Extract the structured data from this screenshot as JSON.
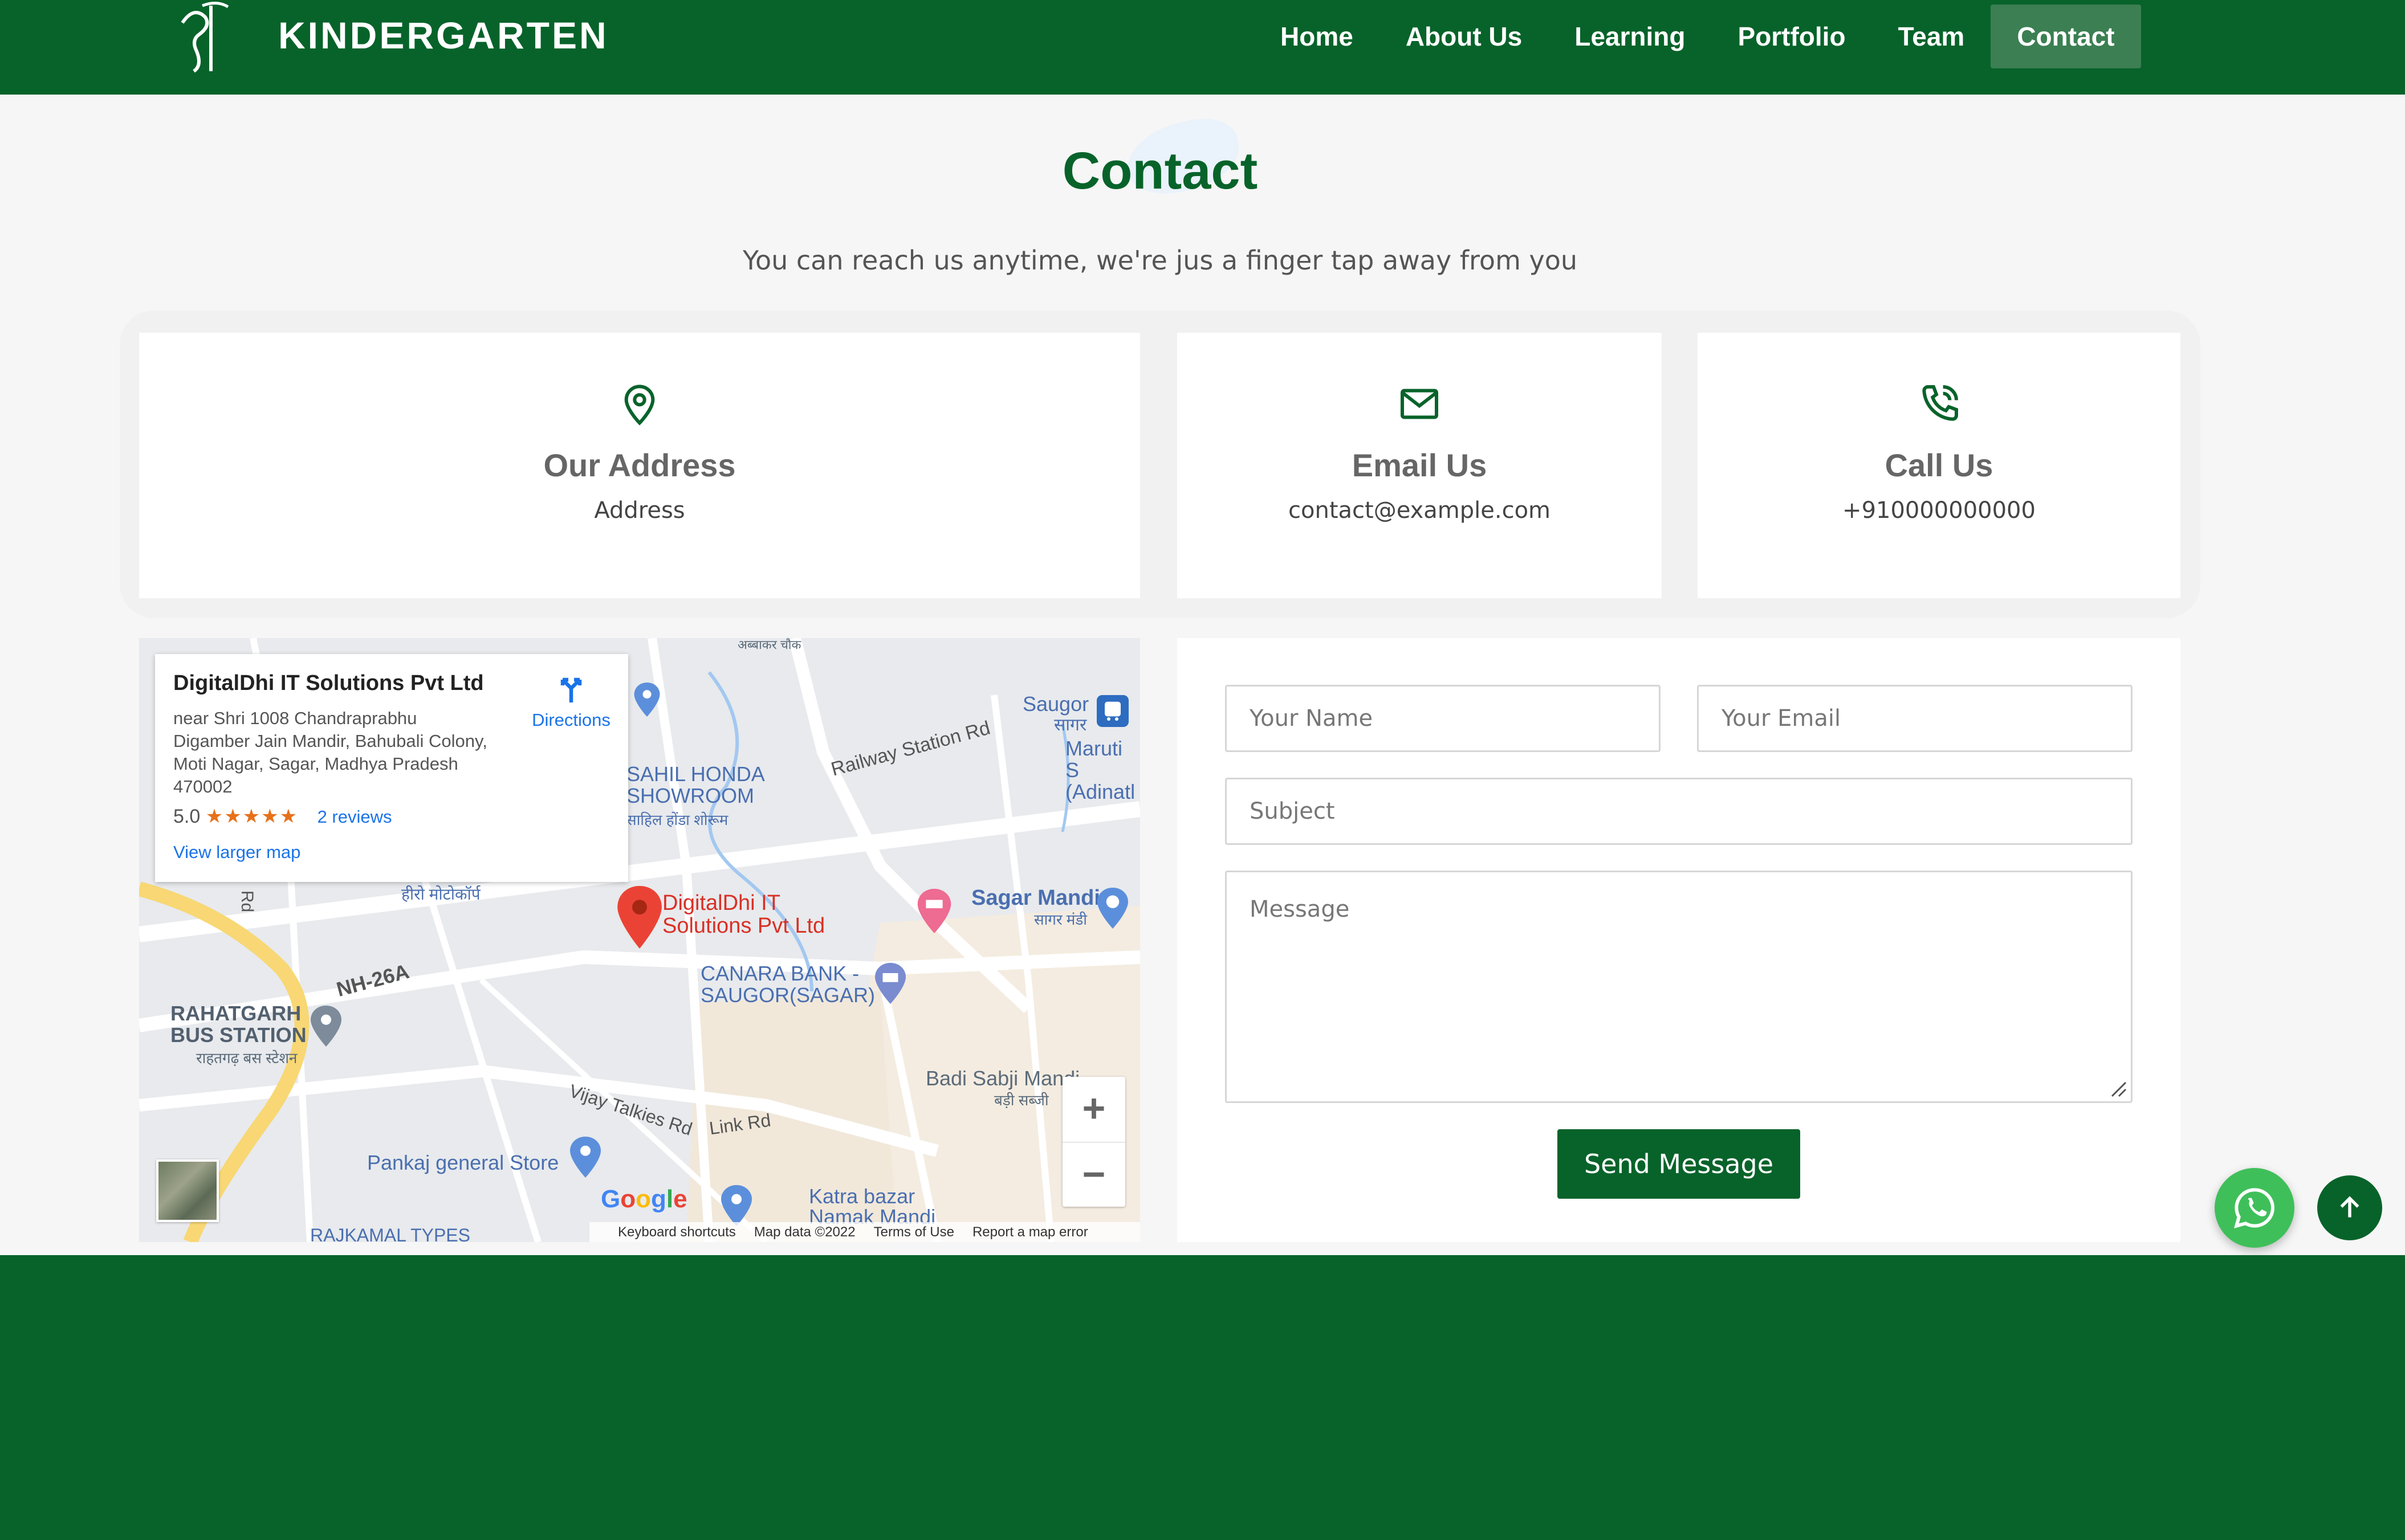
{
  "header": {
    "brand": "KINDERGARTEN",
    "nav": [
      "Home",
      "About Us",
      "Learning",
      "Portfolio",
      "Team",
      "Contact"
    ],
    "active_nav": "Contact"
  },
  "section": {
    "title": "Contact",
    "subtitle": "You can reach us anytime, we're jus a finger tap away from you"
  },
  "cards": [
    {
      "icon": "map-pin-icon",
      "title": "Our Address",
      "text": "Address"
    },
    {
      "icon": "envelope-icon",
      "title": "Email Us",
      "text": "contact@example.com"
    },
    {
      "icon": "phone-icon",
      "title": "Call Us",
      "text": "+910000000000"
    }
  ],
  "map": {
    "place_name": "DigitalDhi IT Solutions Pvt Ltd",
    "address": "near Shri 1008 Chandraprabhu Digamber Jain Mandir, Bahubali Colony, Moti Nagar, Sagar, Madhya Pradesh 470002",
    "rating": "5.0",
    "stars": "★★★★★",
    "reviews": "2 reviews",
    "directions": "Directions",
    "view_larger": "View larger map",
    "pin_label": "DigitalDhi IT Solutions Pvt Ltd",
    "labels": {
      "saugor": "Saugor",
      "saugor_hi": "सागर",
      "maruti": "Maruti S (Adinatl",
      "railway": "Railway Station Rd",
      "sahil": "SAHIL HONDA SHOWROOM",
      "sahil_hi": "साहिल होंडा शोरूम",
      "hiro": "हीरो मोटोकॉर्प",
      "sagar_mandi": "Sagar Mandi",
      "sagar_mandi_hi": "सागर मंडी",
      "canara": "CANARA BANK - SAUGOR(SAGAR)",
      "nh26a": "NH-26A",
      "rahatgarh": "RAHATGARH BUS STATION",
      "rahatgarh_hi": "राहतगढ़ बस स्टेशन",
      "badi_sabji": "Badi Sabji Mandi",
      "badi_sabji_hi": "बड़ी सब्जी",
      "vijay": "Vijay Talkies Rd",
      "link": "Link Rd",
      "pankaj": "Pankaj general Store",
      "katra": "Katra bazar Namak Mandi Sagar",
      "rajkamal": "RAJKAMAL TYPES",
      "chowk": "अब्बाकर चौक",
      "rd": "Rd"
    },
    "footer": [
      "Keyboard shortcuts",
      "Map data ©2022",
      "Terms of Use",
      "Report a map error"
    ],
    "google": "Google",
    "zoom_in": "+",
    "zoom_out": "−"
  },
  "form": {
    "name_placeholder": "Your Name",
    "email_placeholder": "Your Email",
    "subject_placeholder": "Subject",
    "message_placeholder": "Message",
    "send": "Send Message"
  },
  "colors": {
    "brand_green": "#07632a",
    "whatsapp_green": "#3fbf5a"
  }
}
